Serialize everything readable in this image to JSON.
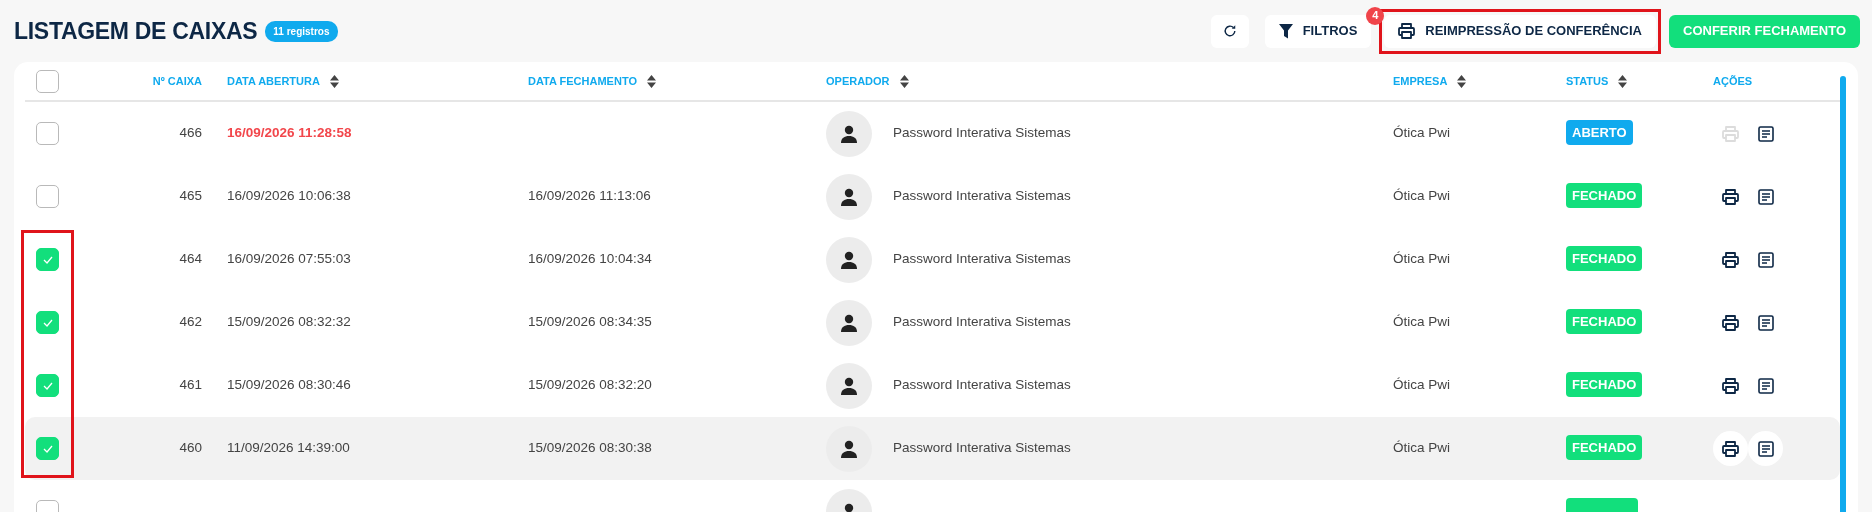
{
  "header": {
    "title": "LISTAGEM DE CAIXAS",
    "count_badge": "11 registros"
  },
  "toolbar": {
    "filter_label": "FILTROS",
    "reprint": {
      "label": "REIMPRESSÃO DE CONFERÊNCIA",
      "badge": "4",
      "highlighted": true
    },
    "confirm_label": "CONFERIR FECHAMENTO"
  },
  "table": {
    "columns": [
      {
        "label": "Nº CAIXA",
        "sortable": false
      },
      {
        "label": "DATA ABERTURA",
        "sortable": true
      },
      {
        "label": "DATA FECHAMENTO",
        "sortable": true
      },
      {
        "label": "OPERADOR",
        "sortable": true
      },
      {
        "label": "EMPRESA",
        "sortable": true
      },
      {
        "label": "STATUS",
        "sortable": true
      },
      {
        "label": "AÇÕES",
        "sortable": false
      }
    ],
    "header_checked": false,
    "rows": [
      {
        "kind": "full",
        "number": "466",
        "opened": "16/09/2026 11:28:58",
        "overdue": true,
        "operator": "Password Interativa Sistemas",
        "company": "Ótica Pwi",
        "status": {
          "label": "ABERTO",
          "color": "#10aaee"
        },
        "checked": false,
        "highlighted": false,
        "hovered": false,
        "print_enabled": false
      },
      {
        "kind": "full",
        "number": "465",
        "opened": "16/09/2026 10:06:38",
        "overdue": false,
        "closed": "16/09/2026 11:13:06",
        "operator": "Password Interativa Sistemas",
        "company": "Ótica Pwi",
        "status": {
          "label": "FECHADO",
          "color": "#12df7c"
        },
        "checked": false,
        "highlighted": false,
        "hovered": false,
        "print_enabled": true
      },
      {
        "kind": "full",
        "number": "464",
        "opened": "16/09/2026 07:55:03",
        "overdue": false,
        "closed": "16/09/2026 10:04:34",
        "operator": "Password Interativa Sistemas",
        "company": "Ótica Pwi",
        "status": {
          "label": "FECHADO",
          "color": "#12df7c"
        },
        "checked": true,
        "highlighted": true,
        "hovered": false,
        "print_enabled": true
      },
      {
        "kind": "full",
        "number": "462",
        "opened": "15/09/2026 08:32:32",
        "overdue": false,
        "closed": "15/09/2026 08:34:35",
        "operator": "Password Interativa Sistemas",
        "company": "Ótica Pwi",
        "status": {
          "label": "FECHADO",
          "color": "#12df7c"
        },
        "checked": true,
        "highlighted": true,
        "hovered": false,
        "print_enabled": true
      },
      {
        "kind": "full",
        "number": "461",
        "opened": "15/09/2026 08:30:46",
        "overdue": false,
        "closed": "15/09/2026 08:32:20",
        "operator": "Password Interativa Sistemas",
        "company": "Ótica Pwi",
        "status": {
          "label": "FECHADO",
          "color": "#12df7c"
        },
        "checked": true,
        "highlighted": true,
        "hovered": false,
        "print_enabled": true
      },
      {
        "kind": "full",
        "number": "460",
        "opened": "11/09/2026 14:39:00",
        "overdue": false,
        "closed": "15/09/2026 08:30:38",
        "operator": "Password Interativa Sistemas",
        "company": "Ótica Pwi",
        "status": {
          "label": "FECHADO",
          "color": "#12df7c"
        },
        "checked": true,
        "highlighted": true,
        "hovered": true,
        "print_enabled": true
      },
      {
        "kind": "partial",
        "status": {
          "color": "#12df7c"
        },
        "checked": false
      }
    ]
  }
}
